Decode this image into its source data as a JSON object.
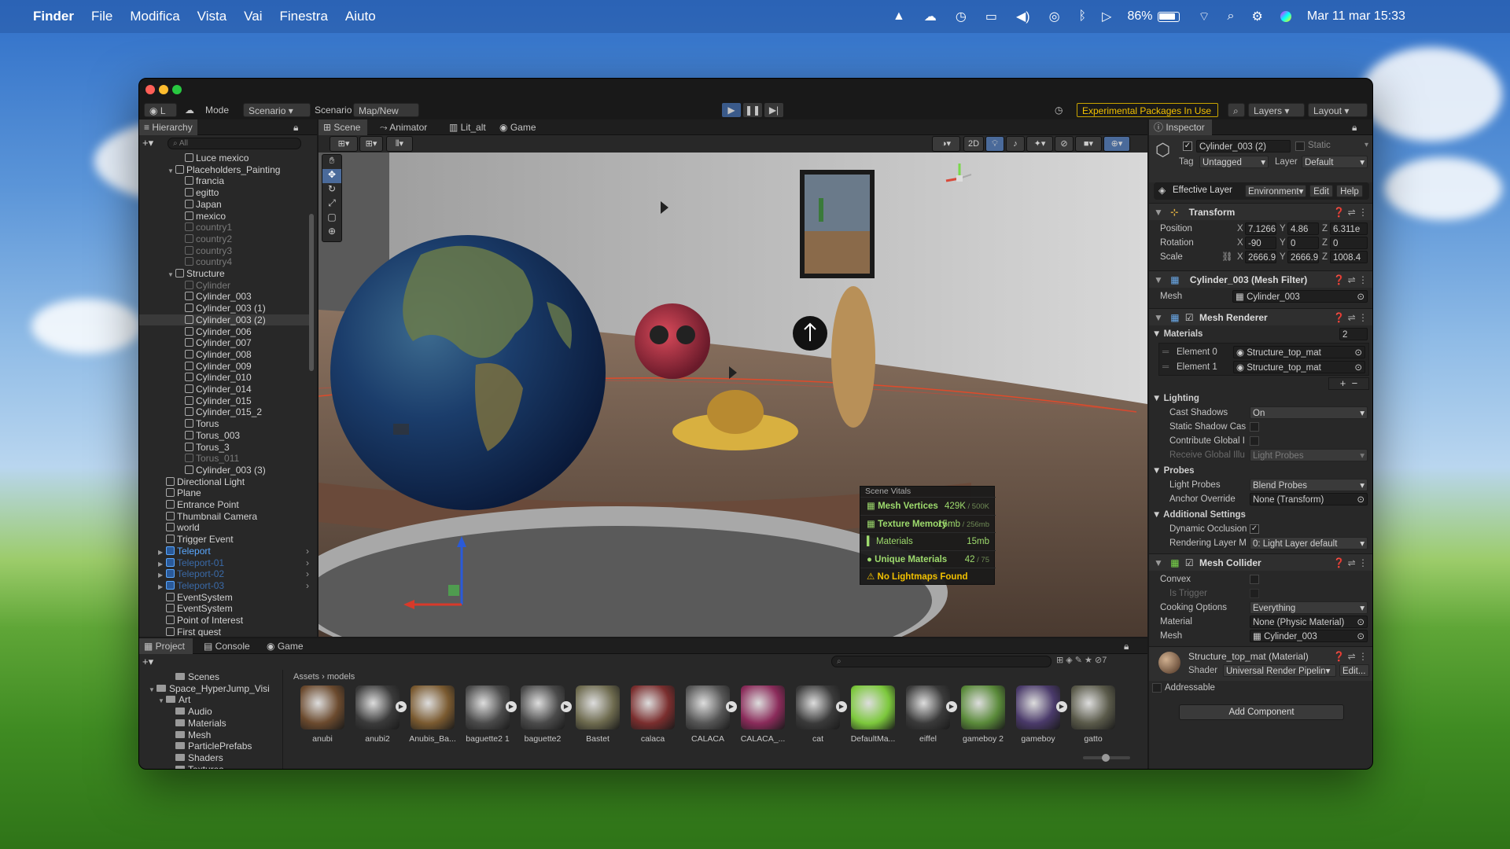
{
  "menubar": {
    "app": "Finder",
    "items": [
      "File",
      "Modifica",
      "Vista",
      "Vai",
      "Finestra",
      "Aiuto"
    ],
    "battery": "86%",
    "datetime": "Mar 11 mar  15:33"
  },
  "toolbar": {
    "mode_label": "Mode",
    "mode_value": "Scenario",
    "scenario_label": "Scenario",
    "scenario_value": "Map/New Gai",
    "experimental": "Experimental Packages In Use",
    "layers": "Layers",
    "layout": "Layout",
    "account_initial": "L"
  },
  "hierarchy": {
    "tab": "Hierarchy",
    "search_placeholder": "All",
    "rows": [
      {
        "label": "Luce mexico",
        "indent": 4,
        "style": "normal"
      },
      {
        "label": "Placeholders_Painting",
        "indent": 3,
        "style": "normal",
        "fold": "▼"
      },
      {
        "label": "francia",
        "indent": 4,
        "style": "normal"
      },
      {
        "label": "egitto",
        "indent": 4,
        "style": "normal"
      },
      {
        "label": "Japan",
        "indent": 4,
        "style": "normal"
      },
      {
        "label": "mexico",
        "indent": 4,
        "style": "normal"
      },
      {
        "label": "country1",
        "indent": 4,
        "style": "dim"
      },
      {
        "label": "country2",
        "indent": 4,
        "style": "dim"
      },
      {
        "label": "country3",
        "indent": 4,
        "style": "dim"
      },
      {
        "label": "country4",
        "indent": 4,
        "style": "dim"
      },
      {
        "label": "Structure",
        "indent": 3,
        "style": "normal",
        "fold": "▼"
      },
      {
        "label": "Cylinder",
        "indent": 4,
        "style": "dim"
      },
      {
        "label": "Cylinder_003",
        "indent": 4,
        "style": "normal"
      },
      {
        "label": "Cylinder_003 (1)",
        "indent": 4,
        "style": "normal"
      },
      {
        "label": "Cylinder_003 (2)",
        "indent": 4,
        "style": "sel"
      },
      {
        "label": "Cylinder_006",
        "indent": 4,
        "style": "normal"
      },
      {
        "label": "Cylinder_007",
        "indent": 4,
        "style": "normal"
      },
      {
        "label": "Cylinder_008",
        "indent": 4,
        "style": "normal"
      },
      {
        "label": "Cylinder_009",
        "indent": 4,
        "style": "normal"
      },
      {
        "label": "Cylinder_010",
        "indent": 4,
        "style": "normal"
      },
      {
        "label": "Cylinder_014",
        "indent": 4,
        "style": "normal"
      },
      {
        "label": "Cylinder_015",
        "indent": 4,
        "style": "normal"
      },
      {
        "label": "Cylinder_015_2",
        "indent": 4,
        "style": "normal"
      },
      {
        "label": "Torus",
        "indent": 4,
        "style": "normal"
      },
      {
        "label": "Torus_003",
        "indent": 4,
        "style": "normal"
      },
      {
        "label": "Torus_3",
        "indent": 4,
        "style": "normal"
      },
      {
        "label": "Torus_011",
        "indent": 4,
        "style": "dim"
      },
      {
        "label": "Cylinder_003 (3)",
        "indent": 4,
        "style": "normal"
      },
      {
        "label": "Directional Light",
        "indent": 2,
        "style": "normal"
      },
      {
        "label": "Plane",
        "indent": 2,
        "style": "normal"
      },
      {
        "label": "Entrance Point",
        "indent": 2,
        "style": "normal"
      },
      {
        "label": "Thumbnail Camera",
        "indent": 2,
        "style": "normal"
      },
      {
        "label": "world",
        "indent": 2,
        "style": "normal"
      },
      {
        "label": "Trigger Event",
        "indent": 2,
        "style": "normal"
      },
      {
        "label": "Teleport",
        "indent": 2,
        "style": "blue",
        "fold": "▶",
        "arrow": true
      },
      {
        "label": "Teleport-01",
        "indent": 2,
        "style": "bluedim",
        "fold": "▶",
        "arrow": true
      },
      {
        "label": "Teleport-02",
        "indent": 2,
        "style": "bluedim",
        "fold": "▶",
        "arrow": true
      },
      {
        "label": "Teleport-03",
        "indent": 2,
        "style": "bluedim",
        "fold": "▶",
        "arrow": true
      },
      {
        "label": "EventSystem",
        "indent": 2,
        "style": "normal"
      },
      {
        "label": "EventSystem",
        "indent": 2,
        "style": "normal"
      },
      {
        "label": "Point of Interest",
        "indent": 2,
        "style": "normal"
      },
      {
        "label": "First quest",
        "indent": 2,
        "style": "normal"
      }
    ]
  },
  "scene": {
    "tabs": [
      "Scene",
      "Animator",
      "Lit_alt",
      "Game"
    ],
    "btn_2d": "2D",
    "vitals": {
      "title": "Scene Vitals",
      "rows": [
        {
          "label": "Mesh Vertices",
          "value": "429K",
          "limit": " / 500K",
          "icon": "grid"
        },
        {
          "label": "Texture Memory",
          "value": "15mb",
          "limit": " / 256mb",
          "icon": "grid"
        },
        {
          "label": "Materials",
          "value": "15mb",
          "limit": "",
          "icon": "bar"
        },
        {
          "label": "Unique Materials",
          "value": "42",
          "limit": " / 75",
          "icon": "circle"
        },
        {
          "label": "No Lightmaps Found",
          "value": "",
          "limit": "",
          "icon": "warn"
        }
      ]
    }
  },
  "inspector": {
    "tab": "Inspector",
    "object_name": "Cylinder_003 (2)",
    "static": "Static",
    "tag_label": "Tag",
    "tag": "Untagged",
    "layer_label": "Layer",
    "layer": "Default",
    "effective_layer_label": "Effective Layer",
    "effective_layer": "Environment",
    "edit": "Edit",
    "help": "Help",
    "transform": {
      "title": "Transform",
      "position_label": "Position",
      "rotation_label": "Rotation",
      "scale_label": "Scale",
      "position": [
        "7.1266",
        "4.86",
        "6.311e"
      ],
      "rotation": [
        "-90",
        "0",
        "0"
      ],
      "scale": [
        "2666.9",
        "2666.9",
        "1008.4"
      ]
    },
    "mesh_filter": {
      "title": "Cylinder_003 (Mesh Filter)",
      "mesh_label": "Mesh",
      "mesh": "Cylinder_003"
    },
    "mesh_renderer": {
      "title": "Mesh Renderer",
      "materials_label": "Materials",
      "materials_count": "2",
      "elements": [
        {
          "label": "Element 0",
          "value": "Structure_top_mat"
        },
        {
          "label": "Element 1",
          "value": "Structure_top_mat"
        }
      ],
      "lighting": "Lighting",
      "cast_shadows_label": "Cast Shadows",
      "cast_shadows": "On",
      "static_shadow": "Static Shadow Cas",
      "contribute_gi": "Contribute Global I",
      "receive_gi_label": "Receive Global Illu",
      "receive_gi": "Light Probes",
      "probes": "Probes",
      "light_probes_label": "Light Probes",
      "light_probes": "Blend Probes",
      "anchor_label": "Anchor Override",
      "anchor": "None (Transform)",
      "additional": "Additional Settings",
      "dynamic_occ": "Dynamic Occlusion",
      "rendering_layer_label": "Rendering Layer M",
      "rendering_layer": "0: Light Layer default"
    },
    "mesh_collider": {
      "title": "Mesh Collider",
      "convex": "Convex",
      "is_trigger": "Is Trigger",
      "cooking_label": "Cooking Options",
      "cooking": "Everything",
      "material_label": "Material",
      "material": "None (Physic Material)",
      "mesh_label": "Mesh",
      "mesh": "Cylinder_003"
    },
    "material": {
      "title": "Structure_top_mat (Material)",
      "shader_label": "Shader",
      "shader": "Universal Render Pipelin",
      "edit": "Edit..."
    },
    "addressable": "Addressable",
    "add_component": "Add Component"
  },
  "project": {
    "tabs": [
      "Project",
      "Console",
      "Game"
    ],
    "count": "7",
    "tree": [
      {
        "label": "Scenes",
        "indent": 3
      },
      {
        "label": "Space_HyperJump_Visi",
        "indent": 1,
        "fold": "▼"
      },
      {
        "label": "Art",
        "indent": 2,
        "fold": "▼"
      },
      {
        "label": "Audio",
        "indent": 3
      },
      {
        "label": "Materials",
        "indent": 3
      },
      {
        "label": "Mesh",
        "indent": 3
      },
      {
        "label": "ParticlePrefabs",
        "indent": 3
      },
      {
        "label": "Shaders",
        "indent": 3
      },
      {
        "label": "Textures",
        "indent": 3,
        "fold": "▶"
      }
    ],
    "breadcrumb": [
      "Assets",
      "models"
    ],
    "assets": [
      {
        "name": "anubi",
        "color": "#6b4a2e",
        "play": false
      },
      {
        "name": "anubi2",
        "color": "#3a3a3a",
        "play": true
      },
      {
        "name": "Anubis_Ba...",
        "color": "#7a5a30",
        "play": false
      },
      {
        "name": "baguette2 1",
        "color": "#4a4a4a",
        "play": true
      },
      {
        "name": "baguette2",
        "color": "#4a4a4a",
        "play": true
      },
      {
        "name": "Bastet",
        "color": "#6d6a4e",
        "play": false
      },
      {
        "name": "calaca",
        "color": "#7a2e2e",
        "play": false
      },
      {
        "name": "CALACA",
        "color": "#555555",
        "play": true
      },
      {
        "name": "CALACA_...",
        "color": "#8a2b5a",
        "play": false
      },
      {
        "name": "cat",
        "color": "#3a3a3a",
        "play": true
      },
      {
        "name": "DefaultMa...",
        "color": "#7cc83c",
        "play": false
      },
      {
        "name": "eiffel",
        "color": "#3a3a3a",
        "play": true
      },
      {
        "name": "gameboy 2",
        "color": "#5a8a3a",
        "play": false
      },
      {
        "name": "gameboy",
        "color": "#4a3a6a",
        "play": true
      },
      {
        "name": "gatto",
        "color": "#5a5a4a",
        "play": false
      }
    ]
  }
}
